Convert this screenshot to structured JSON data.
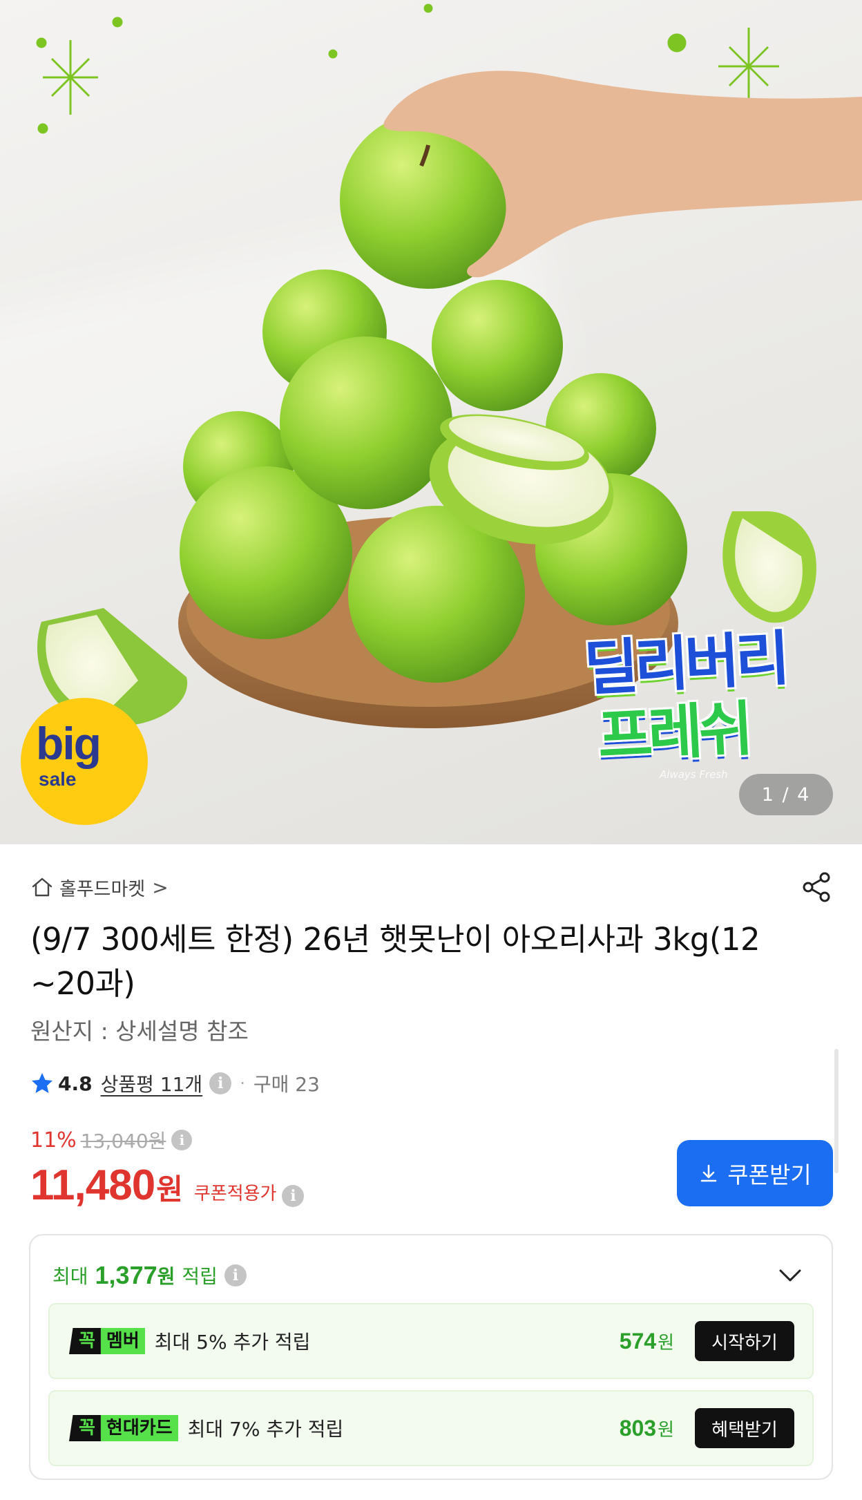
{
  "hero": {
    "page_indicator": "1 / 4",
    "big_badge": {
      "big": "big",
      "sale": "sale"
    },
    "brand_badge": {
      "line1": "딜리버리",
      "line2": "프레쉬",
      "tagline": "Always Fresh"
    },
    "image_subject": "green apples"
  },
  "store": {
    "name": "홀푸드마켓",
    "chevron": ">",
    "icon": "home-icon"
  },
  "product": {
    "title": "(9/7 300세트 한정) 26년 햇못난이 아오리사과 3kg(12~20과)",
    "origin": "원산지 : 상세설명 참조"
  },
  "rating": {
    "score": "4.8",
    "review_label": "상품평 11개",
    "separator": "·",
    "purchase_label": "구매 23"
  },
  "price": {
    "discount": "11%",
    "original": "13,040원",
    "current": "11,480",
    "currency": "원",
    "coupon_label": "쿠폰적용가"
  },
  "coupon_button": {
    "label": "쿠폰받기"
  },
  "reward": {
    "prefix": "최대",
    "amount": "1,377",
    "unit": "원",
    "suffix": "적립",
    "benefits": [
      {
        "tag": "꼭",
        "name": "멤버",
        "desc": "최대 5% 추가 적립",
        "amount": "574",
        "unit": "원",
        "button": "시작하기"
      },
      {
        "tag": "꼭",
        "name": "현대카드",
        "desc": "최대 7% 추가 적립",
        "amount": "803",
        "unit": "원",
        "button": "혜택받기"
      }
    ]
  },
  "info_glyph": "i",
  "colors": {
    "accent_blue": "#1b6df2",
    "price_red": "#e0342e",
    "reward_green": "#2aa02a",
    "badge_green": "#56e04a"
  }
}
